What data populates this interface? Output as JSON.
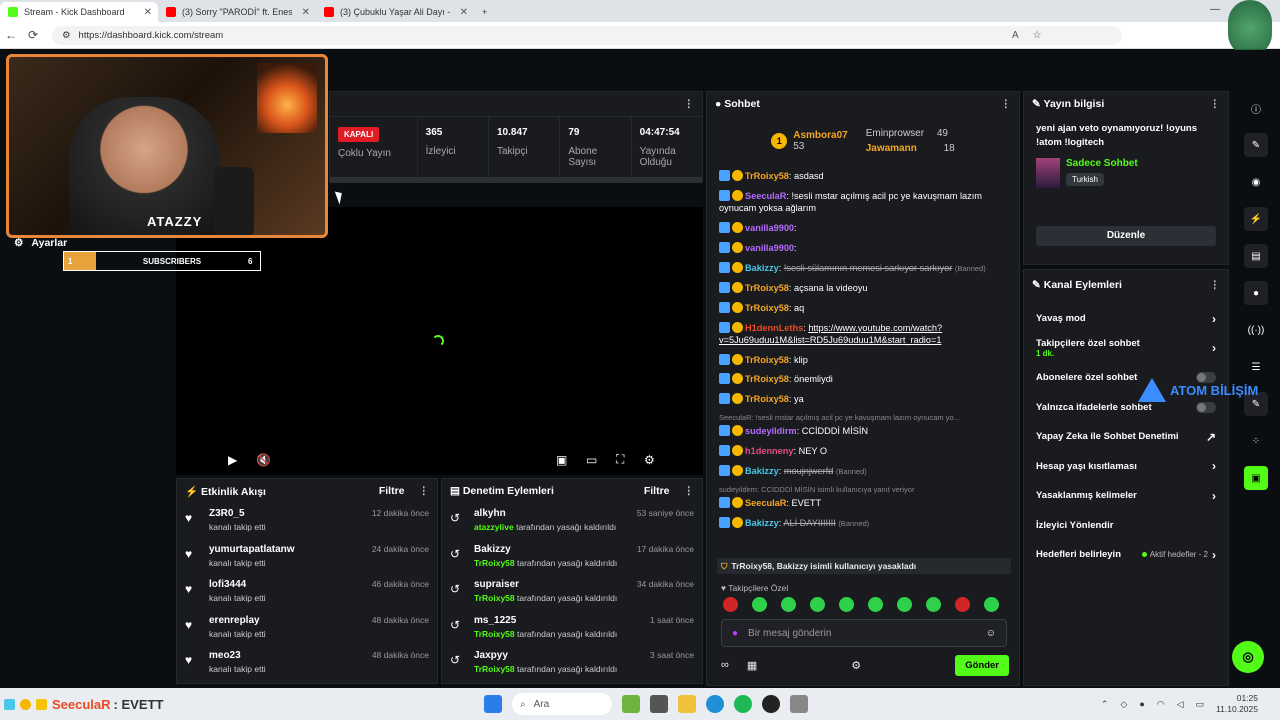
{
  "browser": {
    "tabs": [
      {
        "label": "Stream - Kick Dashboard",
        "color": "#53fc18",
        "active": true
      },
      {
        "label": "(3) Sorry \"PARODİ\" ft. Enes Batur",
        "color": "#ff0000",
        "active": false
      },
      {
        "label": "(3) Çubuklu Yaşar Ali Dayı - Y",
        "color": "#ff0000",
        "active": false
      }
    ],
    "url": "https://dashboard.kick.com/stream"
  },
  "overlay": {
    "logo": "ATAZZY",
    "settings_label": "Ayarlar",
    "sub_goal": {
      "current": "1",
      "label": "SUBSCRIBERS",
      "target": "6",
      "progress": 0.16
    }
  },
  "stats": {
    "status": "KAPALI",
    "multi_stream": "Çoklu Yayın",
    "viewers": {
      "value": "365",
      "label": "İzleyici"
    },
    "followers": {
      "value": "10.847",
      "label": "Takipçi"
    },
    "subs": {
      "value": "79",
      "label": "Abone Sayısı"
    },
    "uptime": {
      "value": "04:47:54",
      "label": "Yayında Olduğu"
    }
  },
  "activity": {
    "title": "Etkinlik Akışı",
    "filter": "Filtre",
    "items": [
      {
        "name": "Z3R0_5",
        "sub": "kanalı takip etti",
        "time": "12 dakika önce"
      },
      {
        "name": "yumurtapatlatanw",
        "sub": "kanalı takip etti",
        "time": "24 dakika önce"
      },
      {
        "name": "lofi3444",
        "sub": "kanalı takip etti",
        "time": "46 dakika önce"
      },
      {
        "name": "erenreplay",
        "sub": "kanalı takip etti",
        "time": "48 dakika önce"
      },
      {
        "name": "meo23",
        "sub": "kanalı takip etti",
        "time": "48 dakika önce"
      }
    ]
  },
  "moderation": {
    "title": "Denetim Eylemleri",
    "filter": "Filtre",
    "items": [
      {
        "name": "alkyhn",
        "by": "atazzylive",
        "sub": "tarafından yasağı kaldırıldı",
        "time": "53 saniye önce"
      },
      {
        "name": "Bakizzy",
        "by": "TrRoixy58",
        "sub": "tarafından yasağı kaldırıldı",
        "time": "17 dakika önce"
      },
      {
        "name": "supraiser",
        "by": "TrRoixy58",
        "sub": "tarafından yasağı kaldırıldı",
        "time": "34 dakika önce"
      },
      {
        "name": "ms_1225",
        "by": "TrRoixy58",
        "sub": "tarafından yasağı kaldırıldı",
        "time": "1 saat önce"
      },
      {
        "name": "Jaxpyy",
        "by": "TrRoixy58",
        "sub": "tarafından yasağı kaldırıldı",
        "time": "3 saat önce"
      }
    ]
  },
  "chat": {
    "title": "Sohbet",
    "leaders": {
      "first": {
        "rank": "1",
        "name": "Asmbora07",
        "count": "53"
      },
      "second": {
        "name": "Eminprowser",
        "count": "49"
      },
      "third": {
        "name": "Jawamann",
        "count": "18"
      }
    },
    "messages": [
      {
        "user": "TrRoixy58",
        "color": "#f5a623",
        "text": "asdasd"
      },
      {
        "user": "SeeculaR",
        "color": "#b56bff",
        "text": "!sesli mstar açılmış acil pc ye kavuşmam lazım oynucam yoksa ağlarım"
      },
      {
        "user": "vanilla9900",
        "color": "#b56bff",
        "text": ""
      },
      {
        "user": "vanilla9900",
        "color": "#b56bff",
        "text": ""
      },
      {
        "user": "Bakizzy",
        "color": "#49c7e8",
        "text": "!sesli sülamının memesi sarkıyor sarkıyor",
        "banned": "(Banned)"
      },
      {
        "user": "TrRoixy58",
        "color": "#f5a623",
        "text": "açsana la videoyu"
      },
      {
        "user": "TrRoixy58",
        "color": "#f5a623",
        "text": "aq"
      },
      {
        "user": "TrRoixy58",
        "color": "#f5a623",
        "text": "klip"
      },
      {
        "user": "TrRoixy58",
        "color": "#f5a623",
        "text": "önemliydi"
      },
      {
        "user": "TrRoixy58",
        "color": "#f5a623",
        "text": "ya"
      },
      {
        "user": "sudeyildirm",
        "color": "#b56bff",
        "text": "CCİDDDİ MİSİN"
      },
      {
        "user": "h1denneny",
        "color": "#e94b8a",
        "text": "NEY O"
      },
      {
        "user": "Bakizzy",
        "color": "#49c7e8",
        "text": "moujnjwerfd",
        "banned": "(Banned)"
      },
      {
        "user": "SeeculaR",
        "color": "#f5a623",
        "text": "EVETT"
      },
      {
        "user": "Bakizzy",
        "color": "#49c7e8",
        "text": "ALİ DAYIIIIIII",
        "banned": "(Banned)"
      }
    ],
    "link_user": "H1dennLeths",
    "link": "https://www.youtube.com/watch?v=5Ju69uduu1M&list=RD5Ju69uduu1M&start_radio=1",
    "reply1": "SeeculaR: !sesli mstar açılmış acil pc ye kavuşmam lazım oynucam yo...",
    "reply2": "sudeyildirm: CCİDDDİ MİSİN isimli kullanıcıya yanıt veriyor",
    "ban_notice": "TrRoixy58, Bakizzy isimli kullanıcıyı yasakladı",
    "emote_label": "Takipçilere Özel",
    "placeholder": "Bir mesaj gönderin",
    "send_label": "Gönder"
  },
  "info": {
    "title": "Yayın bilgisi",
    "description": "yeni ajan veto oynamıyoruz! !oyuns !atom !logitech",
    "category": "Sadece Sohbet",
    "tag": "Turkish",
    "edit_label": "Düzenle"
  },
  "channel_actions": {
    "title": "Kanal Eylemleri",
    "items": [
      {
        "label": "Yavaş mod",
        "kind": "chevron"
      },
      {
        "label": "Takipçilere özel sohbet",
        "green": "1 dk.",
        "kind": "chevron"
      },
      {
        "label": "Abonelere özel sohbet",
        "kind": "toggle"
      },
      {
        "label": "Yalnızca ifadelerle sohbet",
        "kind": "toggle"
      },
      {
        "label": "Yapay Zeka ile Sohbet Denetimi",
        "kind": "external"
      },
      {
        "label": "Hesap yaşı kısıtlaması",
        "kind": "chevron"
      },
      {
        "label": "Yasaklanmış kelimeler",
        "kind": "chevron"
      },
      {
        "label": "İzleyici Yönlendir",
        "kind": "none"
      },
      {
        "label": "Hedefleri belirleyin",
        "extra": "Aktif hedefler - 2",
        "kind": "chevron"
      }
    ]
  },
  "watermark": "ATOM BİLİŞİM",
  "taskbar": {
    "chat_user": "SeeculaR",
    "chat_text": ": EVETT",
    "search": "Ara",
    "time": "01:25",
    "date": "11.10.2025"
  }
}
